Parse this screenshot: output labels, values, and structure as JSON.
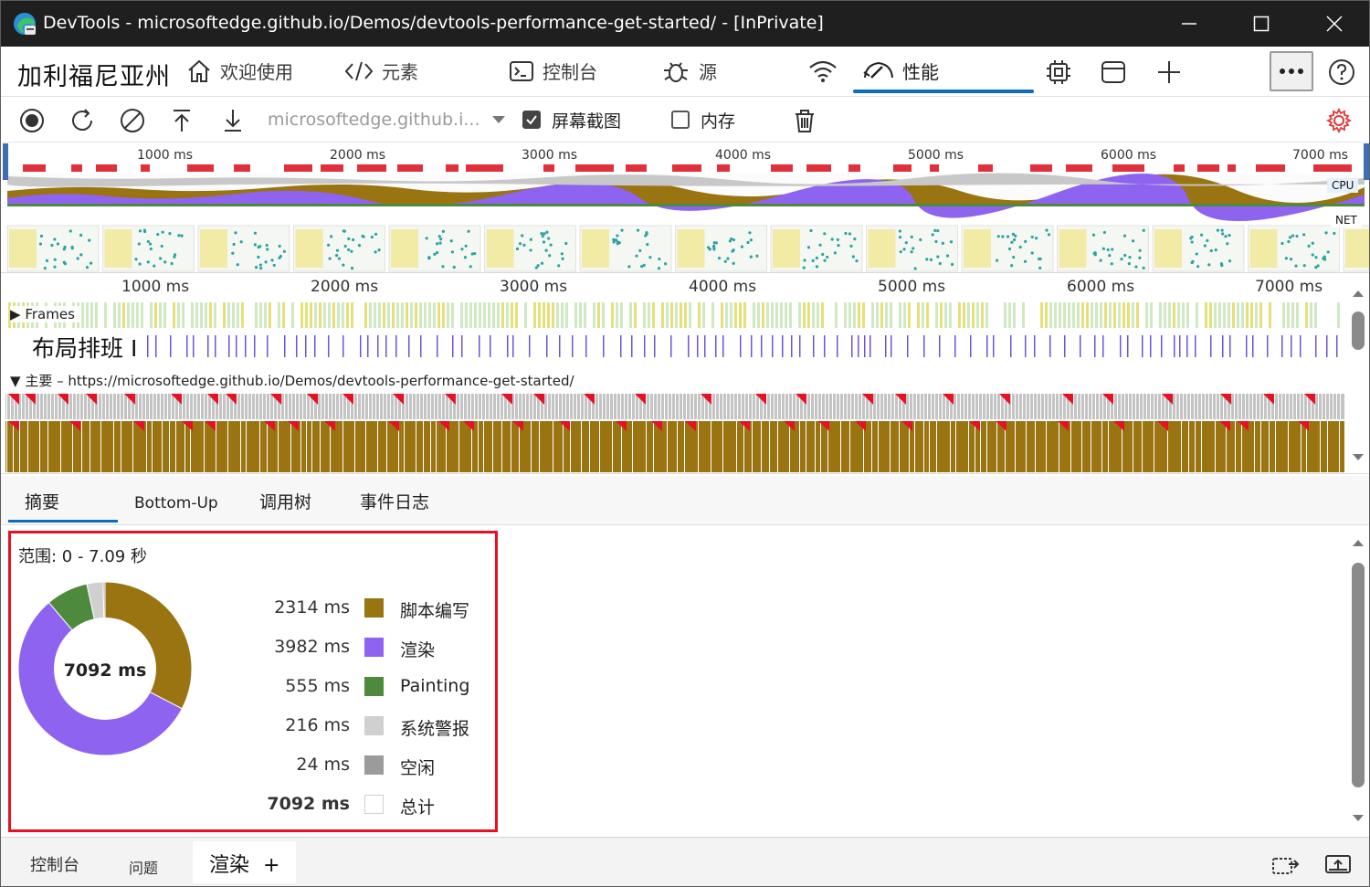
{
  "window": {
    "title": "DevTools - microsoftedge.github.io/Demos/devtools-performance-get-started/ - [InPrivate]"
  },
  "brand": "加利福尼亚州",
  "tabs": [
    {
      "label": "欢迎使用",
      "icon": "home-icon"
    },
    {
      "label": "元素",
      "icon": "code-icon"
    },
    {
      "label": "控制台",
      "icon": "console-icon"
    },
    {
      "label": "源",
      "icon": "bug-icon"
    },
    {
      "label": "",
      "icon": "wifi-icon"
    },
    {
      "label": "性能",
      "icon": "performance-icon",
      "active": true
    }
  ],
  "toolbar": {
    "url": "microsoftedge.github.i...",
    "screenshots_label": "屏幕截图",
    "screenshots_checked": true,
    "memory_label": "内存",
    "memory_checked": false
  },
  "overview": {
    "ticks": [
      "1000 ms",
      "2000 ms",
      "3000 ms",
      "4000 ms",
      "5000 ms",
      "6000 ms",
      "7000 ms"
    ],
    "cpu_label": "CPU",
    "net_label": "NET"
  },
  "flame": {
    "ticks": [
      "1000 ms",
      "2000 ms",
      "3000 ms",
      "4000 ms",
      "5000 ms",
      "6000 ms",
      "7000 ms"
    ],
    "frames_label": "Frames",
    "layout_label": "布局排班 I",
    "main_label": "主要 – https://microsoftedge.github.io/Demos/devtools-performance-get-started/"
  },
  "subtabs": [
    "摘要",
    "Bottom-Up",
    "调用树",
    "事件日志"
  ],
  "summary": {
    "range": "范围: 0 - 7.09 秒",
    "total_center": "7092 ms",
    "rows": [
      {
        "ms": "2314 ms",
        "label": "脚本编写",
        "color": "#9a7410"
      },
      {
        "ms": "3982 ms",
        "label": "渲染",
        "color": "#8e63f0"
      },
      {
        "ms": "555 ms",
        "label": "Painting",
        "color": "#4e8a3e"
      },
      {
        "ms": "216 ms",
        "label": "系统警报",
        "color": "#d0d0d0"
      },
      {
        "ms": "24 ms",
        "label": "空闲",
        "color": "#9b9b9b"
      },
      {
        "ms": "7092 ms",
        "label": "总计",
        "color": "#ffffff"
      }
    ]
  },
  "chart_data": {
    "type": "pie",
    "categories": [
      "脚本编写",
      "渲染",
      "Painting",
      "系统警报",
      "空闲"
    ],
    "values": [
      2314,
      3982,
      555,
      216,
      24
    ],
    "title": "7092 ms"
  },
  "drawer": {
    "tabs": [
      "控制台",
      "问题",
      "渲染"
    ]
  }
}
